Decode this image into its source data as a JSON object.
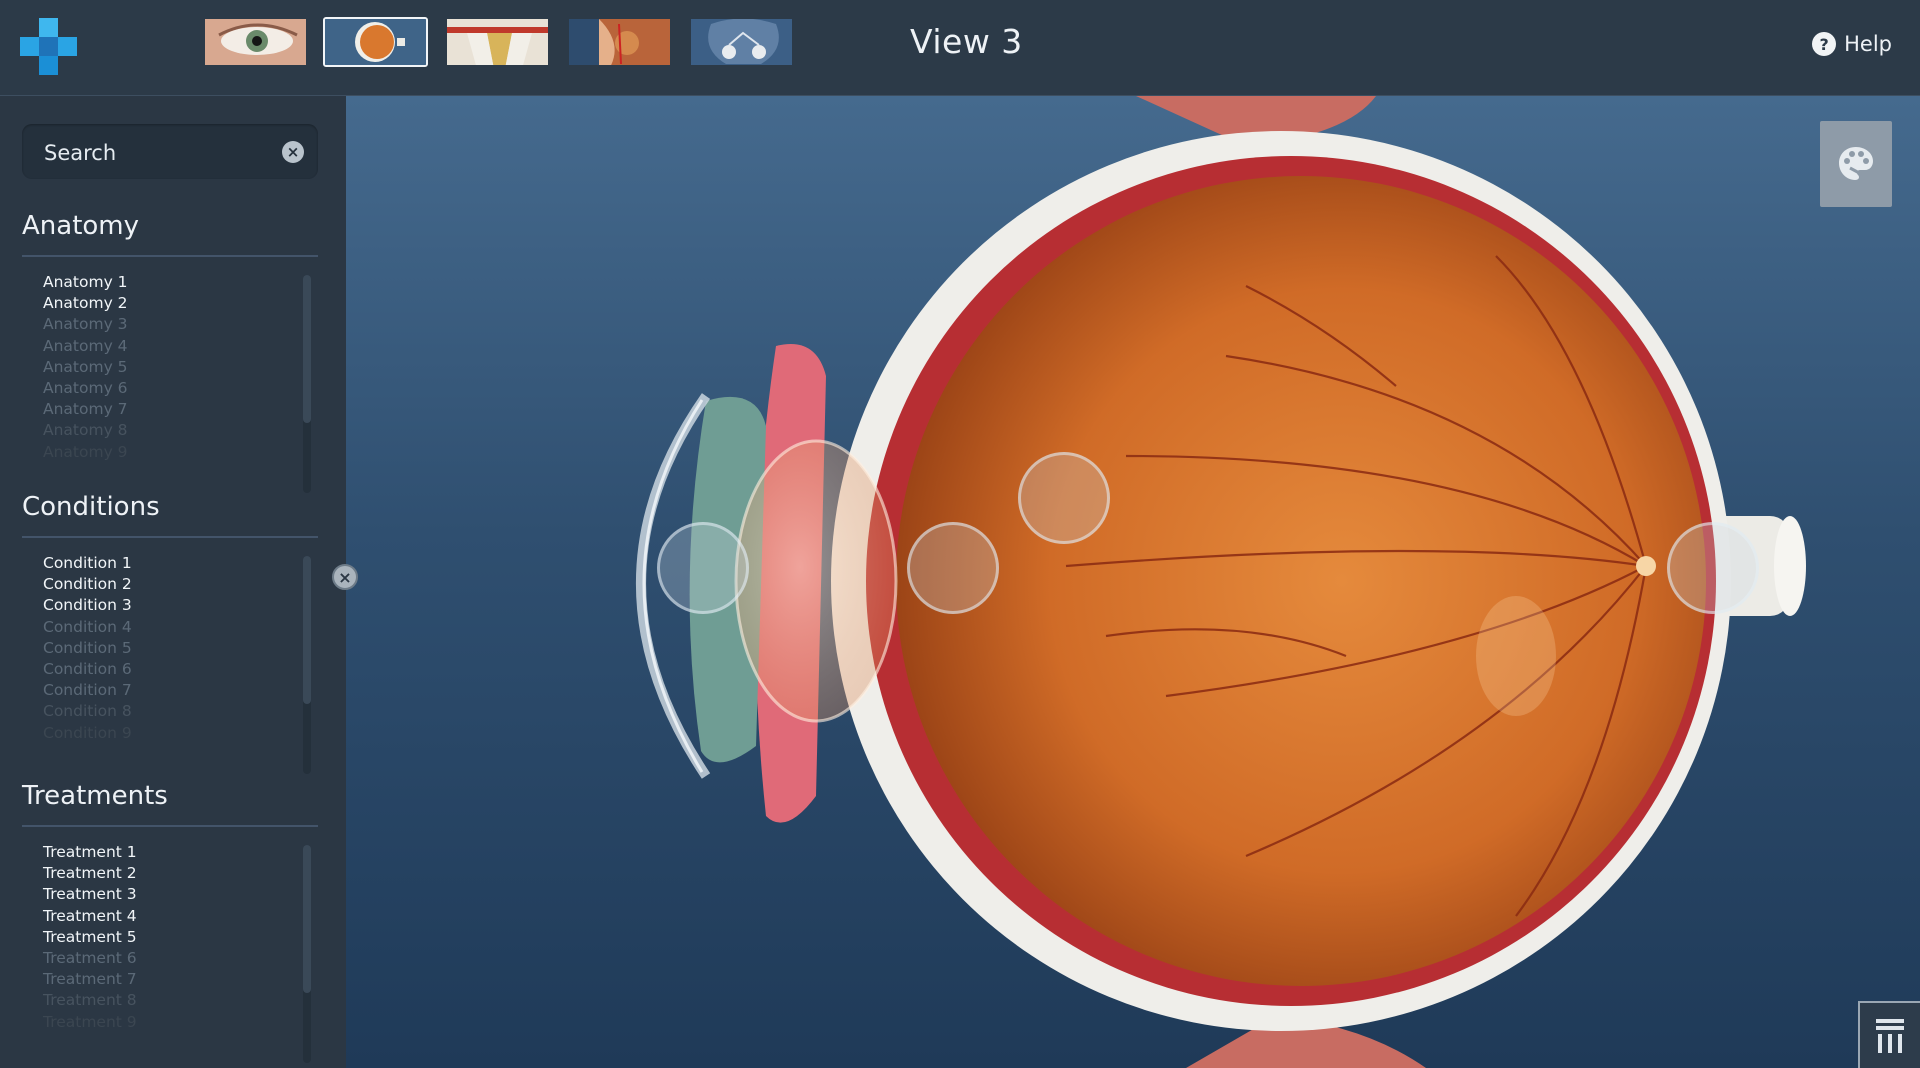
{
  "header": {
    "view_title": "View 3",
    "help_label": "Help",
    "thumbnails": [
      {
        "name": "eye-external"
      },
      {
        "name": "eyeball"
      },
      {
        "name": "cross-section"
      },
      {
        "name": "side-profile"
      },
      {
        "name": "brain-optic"
      }
    ],
    "active_thumbnail": 1
  },
  "sidebar": {
    "search_placeholder": "Search",
    "anatomy": {
      "title": "Anatomy",
      "items": [
        "Anatomy 1",
        "Anatomy 2",
        "Anatomy 3",
        "Anatomy 4",
        "Anatomy 5",
        "Anatomy 6",
        "Anatomy 7",
        "Anatomy 8",
        "Anatomy 9"
      ]
    },
    "conditions": {
      "title": "Conditions",
      "items": [
        "Condition 1",
        "Condition 2",
        "Condition 3",
        "Condition 4",
        "Condition 5",
        "Condition 6",
        "Condition 7",
        "Condition 8",
        "Condition 9"
      ]
    },
    "treatments": {
      "title": "Treatments",
      "items": [
        "Treatment 1",
        "Treatment 2",
        "Treatment 3",
        "Treatment 4",
        "Treatment 5",
        "Treatment 6",
        "Treatment 7",
        "Treatment 8",
        "Treatment 9"
      ]
    }
  },
  "colors": {
    "topbar": "#2c3a48",
    "sidebar": "#2b3744",
    "viewer_top": "#456a8e",
    "viewer_bottom": "#1f3a58",
    "logo_accent": "#1e9fe0",
    "iris_orange": "#d7772d",
    "sclera": "#f0f0ec"
  },
  "icons": {
    "logo": "cross-logo-icon",
    "help": "help-circle-icon",
    "search_clear": "close-circle-icon",
    "palette": "palette-icon",
    "menu": "menu-bars-icon"
  }
}
